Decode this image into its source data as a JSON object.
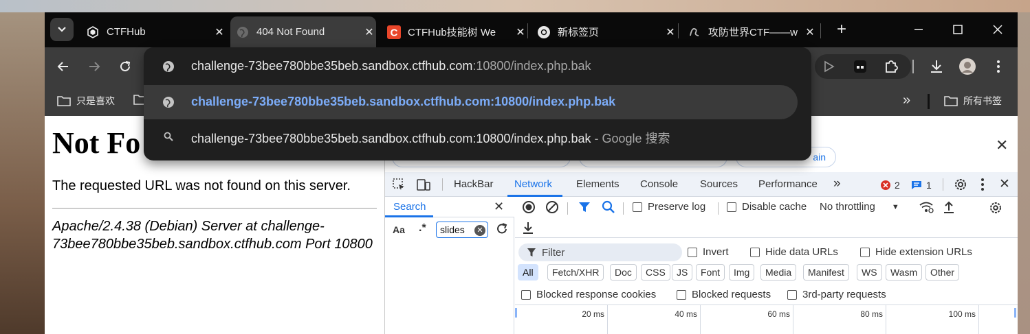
{
  "tabs": [
    {
      "title": "CTFHub",
      "icon": "ctfhub-logo-icon",
      "active": false
    },
    {
      "title": "404 Not Found",
      "icon": "globe-icon",
      "active": true
    },
    {
      "title": "CTFHub技能树 We",
      "icon": "ctfhub-c-icon",
      "active": false
    },
    {
      "title": "新标签页",
      "icon": "chrome-icon",
      "active": false
    },
    {
      "title": "攻防世界CTF——w",
      "icon": "adworld-icon",
      "active": false
    }
  ],
  "omnibox": {
    "rows": [
      {
        "text": "challenge-73bee780bbe35beb.sandbox.ctfhub.com",
        "suffix": ":10800/index.php.bak",
        "icon": "globe-icon"
      },
      {
        "text": "challenge-73bee780bbe35beb.sandbox.ctfhub.com:10800/index.php.bak",
        "icon": "globe-icon"
      },
      {
        "text": "challenge-73bee780bbe35beb.sandbox.ctfhub.com:10800/index.php.bak",
        "suffix": " - Google 搜索",
        "icon": "search-icon"
      }
    ]
  },
  "bookmarks": {
    "first": "只是喜欢",
    "all": "所有书签"
  },
  "page": {
    "heading": "Not Fo",
    "message": "The requested URL was not found on this server.",
    "address": "Apache/2.4.38 (Debian) Server at challenge-73bee780bbe35beb.sandbox.ctfhub.com Port 10800"
  },
  "devtools": {
    "pill_3": "ain",
    "tabs": [
      "HackBar",
      "Network",
      "Elements",
      "Console",
      "Sources",
      "Performance"
    ],
    "active_tab": "Network",
    "errors": "2",
    "messages": "1",
    "search": {
      "label": "Search",
      "match_case": "Aa",
      "regex": ".*",
      "query": "slides"
    },
    "network": {
      "preserve_log": "Preserve log",
      "disable_cache": "Disable cache",
      "throttling": "No throttling",
      "filter_placeholder": "Filter",
      "invert": "Invert",
      "hide_data_urls": "Hide data URLs",
      "hide_extension_urls": "Hide extension URLs",
      "types": [
        "All",
        "Fetch/XHR",
        "Doc",
        "CSS",
        "JS",
        "Font",
        "Img",
        "Media",
        "Manifest",
        "WS",
        "Wasm",
        "Other"
      ],
      "active_type": "All",
      "blocked_cookies": "Blocked response cookies",
      "blocked_requests": "Blocked requests",
      "third_party": "3rd-party requests",
      "timeline_ticks": [
        "20 ms",
        "40 ms",
        "60 ms",
        "80 ms",
        "100 ms"
      ]
    }
  }
}
